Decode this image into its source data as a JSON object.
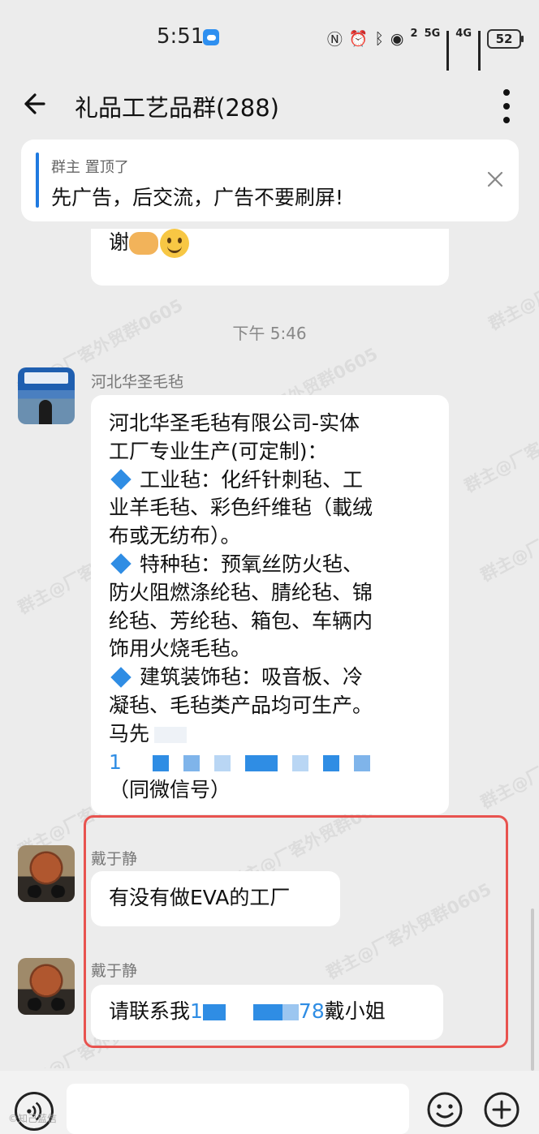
{
  "status": {
    "time": "5:51",
    "sig1": "2",
    "net1": "5G",
    "net2": "4G",
    "battery": "52"
  },
  "header": {
    "title": "礼品工艺品群(288)"
  },
  "pinned": {
    "meta": "群主 置顶了",
    "text": "先广告，后交流，广告不要刷屏!"
  },
  "messages": {
    "prev_text": "谢",
    "timestamp": "下午 5:46",
    "m1": {
      "sender": "河北华圣毛毡",
      "lines": [
        "河北华圣毛毡有限公司-实体",
        "工厂专业生产(可定制)：",
        "工业毡：化纤针刺毡、工",
        "业羊毛毡、彩色纤维毡（載绒",
        "布或无纺布）。",
        "特种毡：预氧丝防火毡、",
        "防火阻燃涤纶毡、腈纶毡、锦",
        "纶毡、芳纶毡、箱包、车辆内",
        "饰用火烧毛毡。",
        "建筑装饰毡：吸音板、冷",
        "凝毡、毛毡类产品均可生产。",
        "马先",
        "1",
        "（同微信号）"
      ]
    },
    "m2": {
      "sender": "戴于静",
      "text": "有没有做EVA的工厂"
    },
    "m3": {
      "sender": "戴于静",
      "prefix": "请联系我",
      "digit": "1",
      "suffix_num": "78",
      "suffix": "戴小姐"
    }
  },
  "watermark": "群主@厂客外贸群0605",
  "footer_mark": "©知己蓝信"
}
